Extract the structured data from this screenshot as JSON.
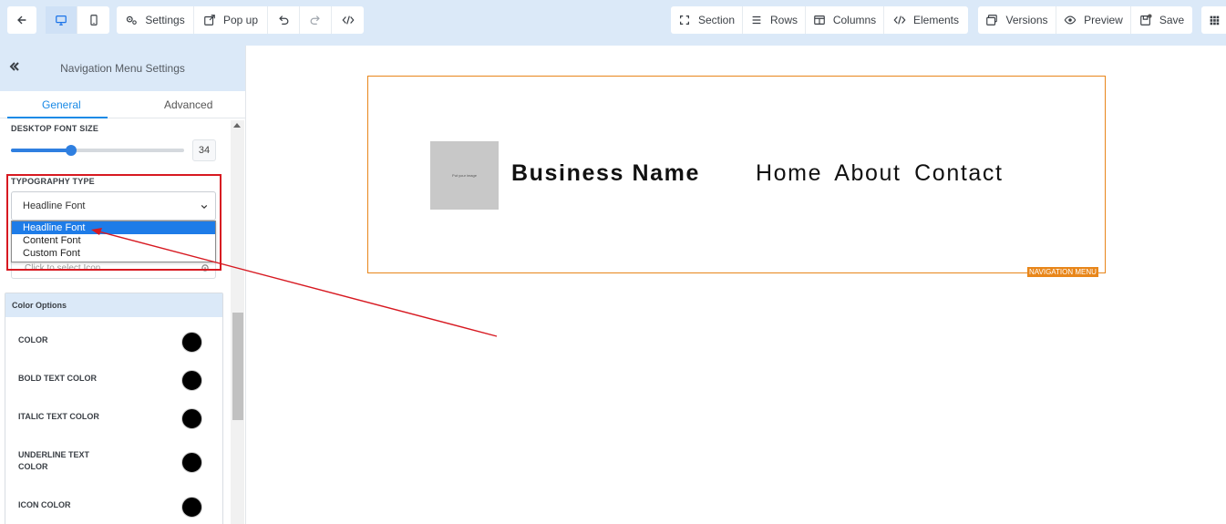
{
  "toolbar": {
    "settings_label": "Settings",
    "popup_label": "Pop up",
    "section_label": "Section",
    "rows_label": "Rows",
    "columns_label": "Columns",
    "elements_label": "Elements",
    "versions_label": "Versions",
    "preview_label": "Preview",
    "save_label": "Save",
    "icons": {
      "back": "arrow-left-icon",
      "desktop": "desktop-icon",
      "mobile": "mobile-icon",
      "settings": "gears-icon",
      "popup": "external-link-icon",
      "undo": "undo-icon",
      "redo": "redo-icon",
      "code": "code-icon",
      "section": "expand-icon",
      "rows": "bars-icon",
      "columns": "columns-icon",
      "elements": "code-icon",
      "versions": "window-icon",
      "preview": "eye-icon",
      "save": "save-icon",
      "apps": "grid-icon"
    }
  },
  "sidebar": {
    "title": "Navigation Menu Settings",
    "tabs": [
      {
        "label": "General",
        "active": true
      },
      {
        "label": "Advanced",
        "active": false
      }
    ],
    "desktop_font_size": {
      "label": "DESKTOP FONT SIZE",
      "value": "34"
    },
    "typography": {
      "label": "TYPOGRAPHY TYPE",
      "selected": "Headline Font",
      "options": [
        "Headline Font",
        "Content Font",
        "Custom Font"
      ]
    },
    "icon_field": {
      "placeholder": "Click to select Icon"
    },
    "color_options": {
      "title": "Color Options",
      "rows": [
        {
          "label": "COLOR",
          "color": "#000000"
        },
        {
          "label": "BOLD TEXT COLOR",
          "color": "#000000"
        },
        {
          "label": "ITALIC TEXT COLOR",
          "color": "#000000"
        },
        {
          "label": "UNDERLINE TEXT COLOR",
          "color": "#000000"
        },
        {
          "label": "ICON COLOR",
          "color": "#000000"
        }
      ]
    }
  },
  "canvas": {
    "logo_text": "Put your image",
    "business_name": "Business Name",
    "nav_links": [
      "Home",
      "About",
      "Contact"
    ],
    "element_badge": "NAVIGATION MENU"
  },
  "colors": {
    "accent_blue": "#1a8ae6",
    "toolbar_bg": "#dbe9f8",
    "selection_orange": "#e8861a",
    "annotation_red": "#d71921"
  }
}
